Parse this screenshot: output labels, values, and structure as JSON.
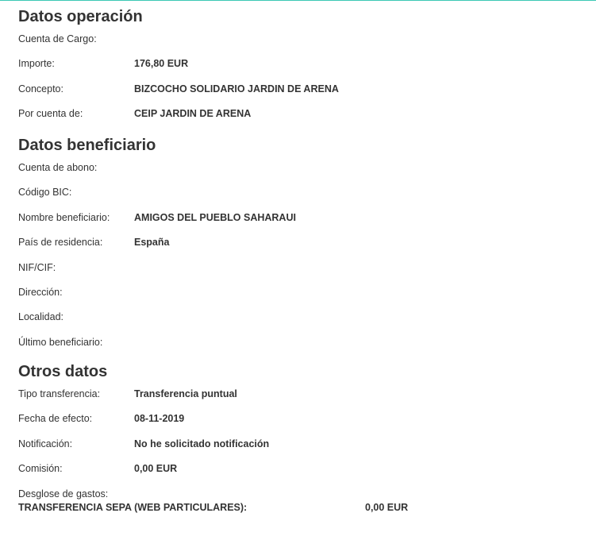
{
  "sections": {
    "operacion": {
      "title": "Datos operación",
      "rows": [
        {
          "label": "Cuenta de Cargo:",
          "value": ""
        },
        {
          "label": "Importe:",
          "value": "176,80 EUR"
        },
        {
          "label": "Concepto:",
          "value": "BIZCOCHO SOLIDARIO JARDIN DE ARENA"
        },
        {
          "label": "Por cuenta de:",
          "value": "CEIP JARDIN DE ARENA"
        }
      ]
    },
    "beneficiario": {
      "title": "Datos beneficiario",
      "rows": [
        {
          "label": "Cuenta de abono:",
          "value": ""
        },
        {
          "label": "Código BIC:",
          "value": ""
        },
        {
          "label": "Nombre beneficiario:",
          "value": "AMIGOS DEL PUEBLO SAHARAUI"
        },
        {
          "label": "País de residencia:",
          "value": "España"
        },
        {
          "label": "NIF/CIF:",
          "value": ""
        },
        {
          "label": "Dirección:",
          "value": ""
        },
        {
          "label": "Localidad:",
          "value": ""
        },
        {
          "label": "Último beneficiario:",
          "value": ""
        }
      ]
    },
    "otros": {
      "title": "Otros datos",
      "rows": [
        {
          "label": "Tipo transferencia:",
          "value": "Transferencia puntual"
        },
        {
          "label": "Fecha de efecto:",
          "value": "08-11-2019"
        },
        {
          "label": "Notificación:",
          "value": "No he solicitado notificación"
        },
        {
          "label": "Comisión:",
          "value": "0,00 EUR"
        }
      ],
      "breakdown": {
        "label": "Desglose de gastos:",
        "item": "TRANSFERENCIA SEPA (WEB PARTICULARES):",
        "amount": "0,00 EUR"
      }
    }
  },
  "colors": {
    "accent_line": "#3cc8b4",
    "text": "#333333"
  }
}
